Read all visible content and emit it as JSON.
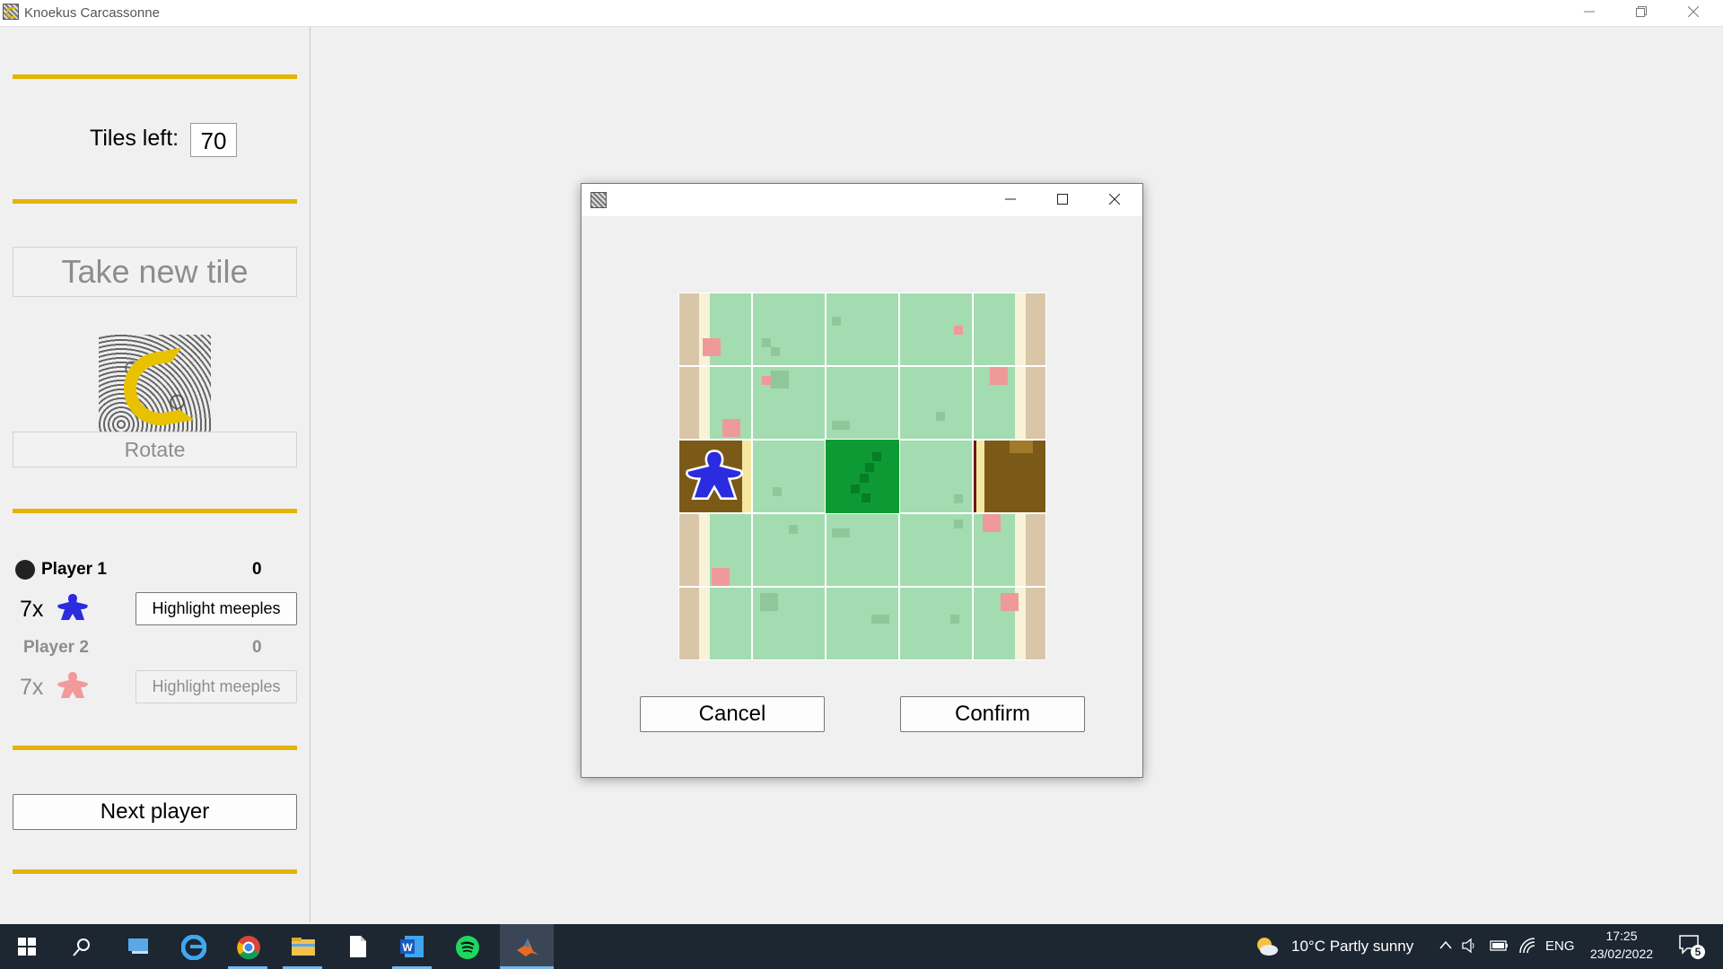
{
  "window": {
    "title": "Knoekus Carcassonne",
    "minimize_icon": "minimize-icon",
    "restore_icon": "restore-icon",
    "close_icon": "close-icon"
  },
  "sidebar": {
    "tiles_left_label": "Tiles left:",
    "tiles_left_value": "70",
    "take_tile_label": "Take new tile",
    "rotate_label": "Rotate",
    "next_player_label": "Next player",
    "accent_color": "#e3b500",
    "players": [
      {
        "name": "Player 1",
        "score": "0",
        "meeples": "7x",
        "meeple_color": "#2b2bdf",
        "highlight_label": "Highlight meeples",
        "active": true
      },
      {
        "name": "Player 2",
        "score": "0",
        "meeples": "7x",
        "meeple_color": "#f29a9a",
        "highlight_label": "Highlight meeples",
        "active": false
      }
    ]
  },
  "dialog": {
    "cancel_label": "Cancel",
    "confirm_label": "Confirm"
  },
  "taskbar": {
    "weather": "10°C  Partly sunny",
    "language": "ENG",
    "time": "17:25",
    "date": "23/02/2022",
    "notifications": "5",
    "apps": [
      "start-icon",
      "search-icon",
      "task-view-icon",
      "edge-icon",
      "chrome-icon",
      "file-explorer-icon",
      "notepad-icon",
      "word-icon",
      "spotify-icon",
      "matlab-icon"
    ]
  }
}
